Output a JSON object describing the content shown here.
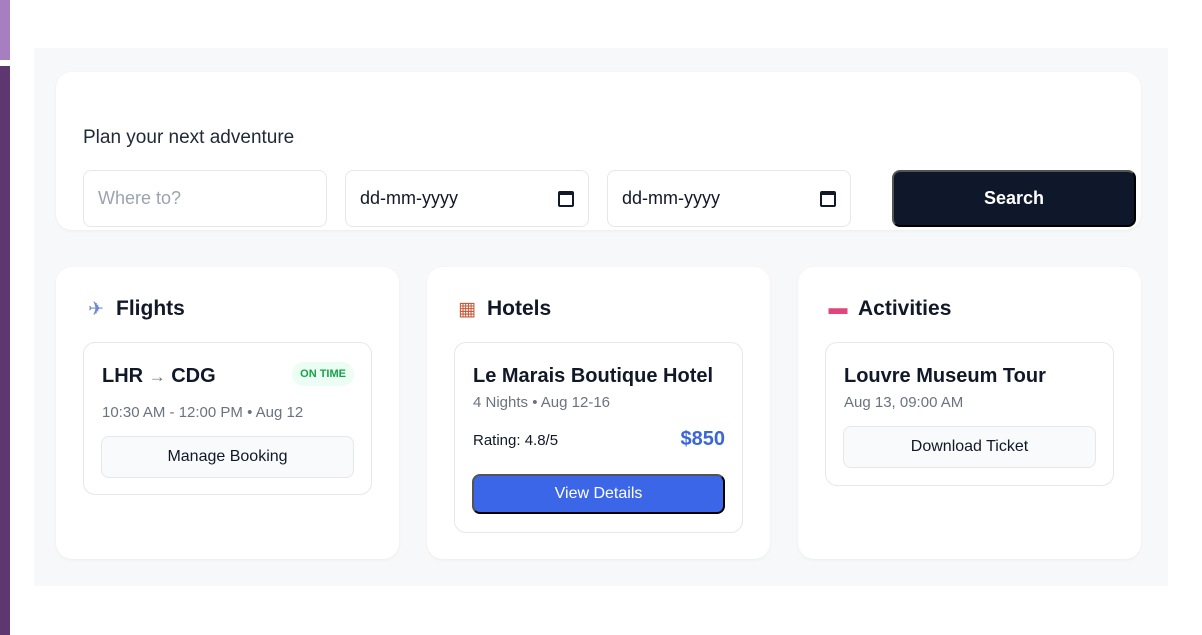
{
  "search": {
    "title": "Plan your next adventure",
    "destination_placeholder": "Where to?",
    "start_date": "dd-mm-yyyy",
    "end_date": "dd-mm-yyyy",
    "button": "Search"
  },
  "flights": {
    "title": "Flights",
    "icon": "airplane-icon",
    "card": {
      "route_from": "LHR",
      "arrow": "→",
      "route_to": "CDG",
      "status": "ON TIME",
      "time": "10:30 AM - 12:00 PM • Aug 12",
      "button": "Manage Booking"
    }
  },
  "hotels": {
    "title": "Hotels",
    "icon": "hotel-icon",
    "card": {
      "name": "Le Marais Boutique Hotel",
      "details": "4 Nights • Aug 12-16",
      "rating": "Rating: 4.8/5",
      "price": "$850",
      "button": "View Details"
    }
  },
  "activities": {
    "title": "Activities",
    "icon": "ticket-icon",
    "card": {
      "name": "Louvre Museum Tour",
      "time": "Aug 13, 09:00 AM",
      "button": "Download Ticket"
    }
  },
  "colors": {
    "primary": "#3b66e8",
    "dark_button": "#0f172a",
    "success": "#16a34a",
    "price": "#3b66d8",
    "background": "#f7f8fa"
  }
}
